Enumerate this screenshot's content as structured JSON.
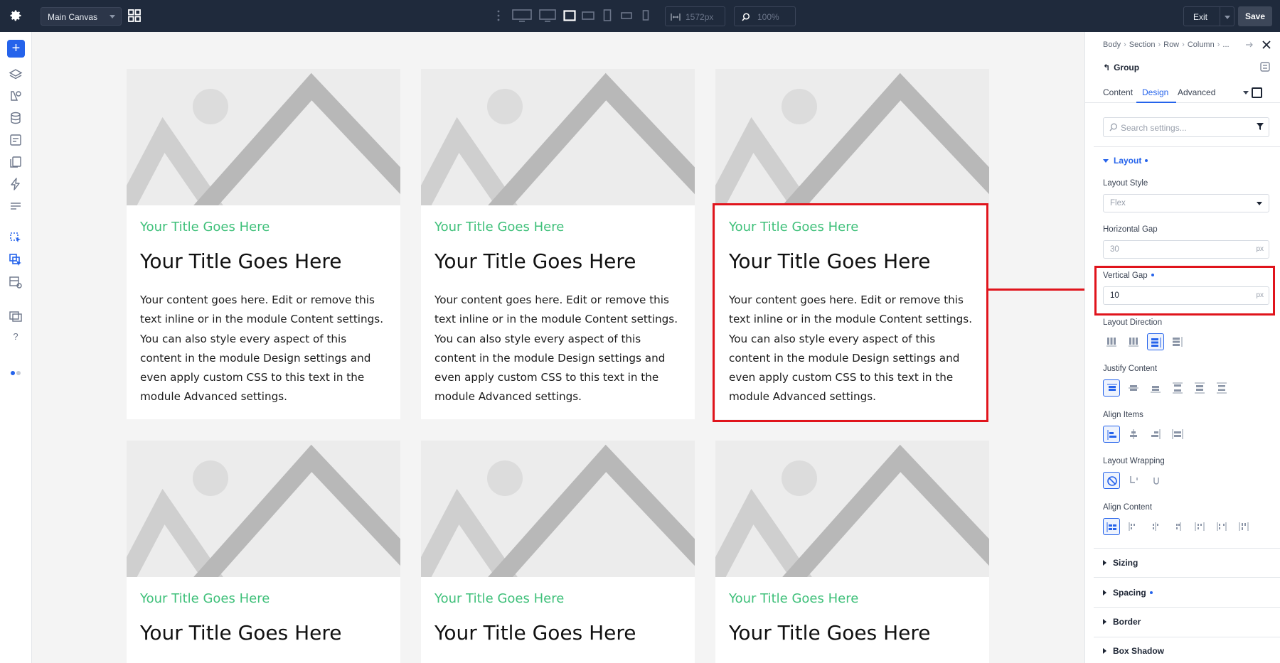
{
  "topbar": {
    "canvas_name": "Main Canvas",
    "width_value": "1572px",
    "zoom_value": "100%",
    "exit_label": "Exit",
    "save_label": "Save"
  },
  "cards": [
    {
      "small_title": "Your Title Goes Here",
      "title": "Your Title Goes Here",
      "body": "Your content goes here. Edit or remove this text inline or in the module Content settings. You can also style every aspect of this content in the module Design settings and even apply custom CSS to this text in the module Advanced settings."
    },
    {
      "small_title": "Your Title Goes Here",
      "title": "Your Title Goes Here",
      "body": "Your content goes here. Edit or remove this text inline or in the module Content settings. You can also style every aspect of this content in the module Design settings and even apply custom CSS to this text in the module Advanced settings."
    },
    {
      "small_title": "Your Title Goes Here",
      "title": "Your Title Goes Here",
      "body": "Your content goes here. Edit or remove this text inline or in the module Content settings. You can also style every aspect of this content in the module Design settings and even apply custom CSS to this text in the module Advanced settings."
    },
    {
      "small_title": "Your Title Goes Here",
      "title": "Your Title Goes Here"
    },
    {
      "small_title": "Your Title Goes Here",
      "title": "Your Title Goes Here"
    },
    {
      "small_title": "Your Title Goes Here",
      "title": "Your Title Goes Here"
    }
  ],
  "panel": {
    "breadcrumb": [
      "Body",
      "Section",
      "Row",
      "Column",
      "..."
    ],
    "element": "Group",
    "tabs": [
      "Content",
      "Design",
      "Advanced"
    ],
    "active_tab": "Design",
    "search_placeholder": "Search settings...",
    "layout_section": "Layout",
    "fields": {
      "layout_style": {
        "label": "Layout Style",
        "value": "Flex"
      },
      "horizontal_gap": {
        "label": "Horizontal Gap",
        "value": "30",
        "unit": "px"
      },
      "vertical_gap": {
        "label": "Vertical Gap",
        "value": "10",
        "unit": "px"
      },
      "layout_direction": {
        "label": "Layout Direction"
      },
      "justify_content": {
        "label": "Justify Content"
      },
      "align_items": {
        "label": "Align Items"
      },
      "layout_wrapping": {
        "label": "Layout Wrapping"
      },
      "align_content": {
        "label": "Align Content"
      }
    },
    "collapsed_sections": [
      "Sizing",
      "Spacing",
      "Border",
      "Box Shadow"
    ]
  },
  "colors": {
    "topbar_bg": "#1f2a3c",
    "accent": "#2563eb",
    "card_subtitle": "#3fc07a",
    "highlight": "#e0141c"
  }
}
